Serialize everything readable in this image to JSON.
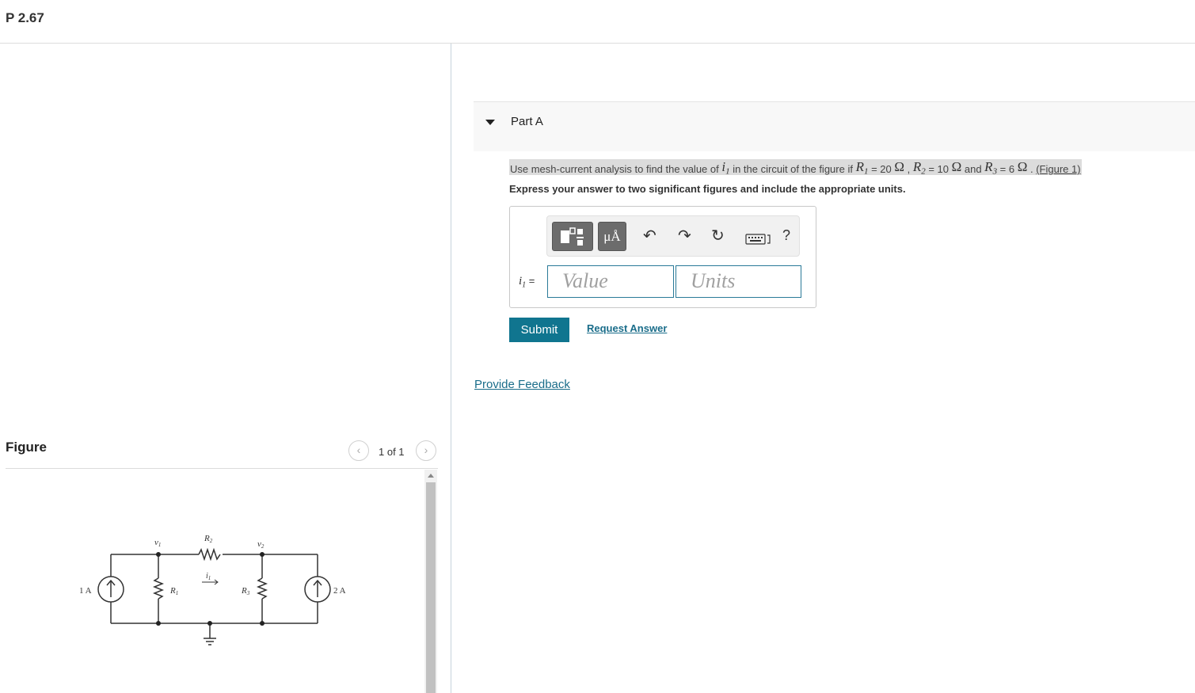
{
  "problem": {
    "title": "P 2.67"
  },
  "figure": {
    "title": "Figure",
    "page_count": "1 of 1",
    "prev_icon": "chevron-left-icon",
    "next_icon": "chevron-right-icon",
    "circuit": {
      "labels": {
        "source1": "1 A",
        "source2": "2 A",
        "v1": "v",
        "v1_sub": "1",
        "v2": "v",
        "v2_sub": "2",
        "r1": "R",
        "r1_sub": "1",
        "r2": "R",
        "r2_sub": "2",
        "r3": "R",
        "r3_sub": "3",
        "i1": "i",
        "i1_sub": "1"
      }
    }
  },
  "part_a": {
    "label": "Part A",
    "question": {
      "text_1": "Use mesh-current analysis to find the value of ",
      "var_i": "i",
      "var_i_sub": "1",
      "text_2": " in the circuit of the figure if ",
      "r1": "R",
      "r1_sub": "1",
      "r1_value": " = 20 ",
      "ohm": "Ω",
      "sep_1": " , ",
      "r2": "R",
      "r2_sub": "2",
      "r2_value": " = 10 ",
      "and": " and ",
      "r3": "R",
      "r3_sub": "3",
      "r3_value": " = 6 ",
      "sep_2": " . ",
      "figure_link": "(Figure 1)"
    },
    "instruction": "Express your answer to two significant figures and include the appropriate units.",
    "toolbar": {
      "units_label": "μÅ",
      "templates_icon": "templates-icon",
      "undo_icon": "undo-icon",
      "redo_icon": "redo-icon",
      "reset_icon": "reset-icon",
      "keyboard_icon": "keyboard-icon",
      "help_label": "?"
    },
    "answer": {
      "var": "i",
      "var_sub": "1",
      "equals": " =",
      "value_placeholder": "Value",
      "units_placeholder": "Units"
    },
    "submit_label": "Submit",
    "request_answer_label": "Request Answer"
  },
  "feedback_label": "Provide Feedback"
}
